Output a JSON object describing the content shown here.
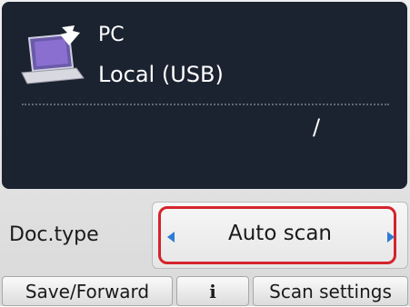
{
  "destination": {
    "name": "PC",
    "connection": "Local (USB)",
    "icon": "laptop-icon",
    "path_text": "/"
  },
  "doc_type": {
    "label": "Doc.type",
    "value": "Auto scan",
    "highlight_color": "#d4242b",
    "arrow_color": "#2c7dd3"
  },
  "softkeys": {
    "left": "Save/Forward",
    "center": "i",
    "right": "Scan settings"
  },
  "colors": {
    "panel_bg": "#1c2330"
  }
}
